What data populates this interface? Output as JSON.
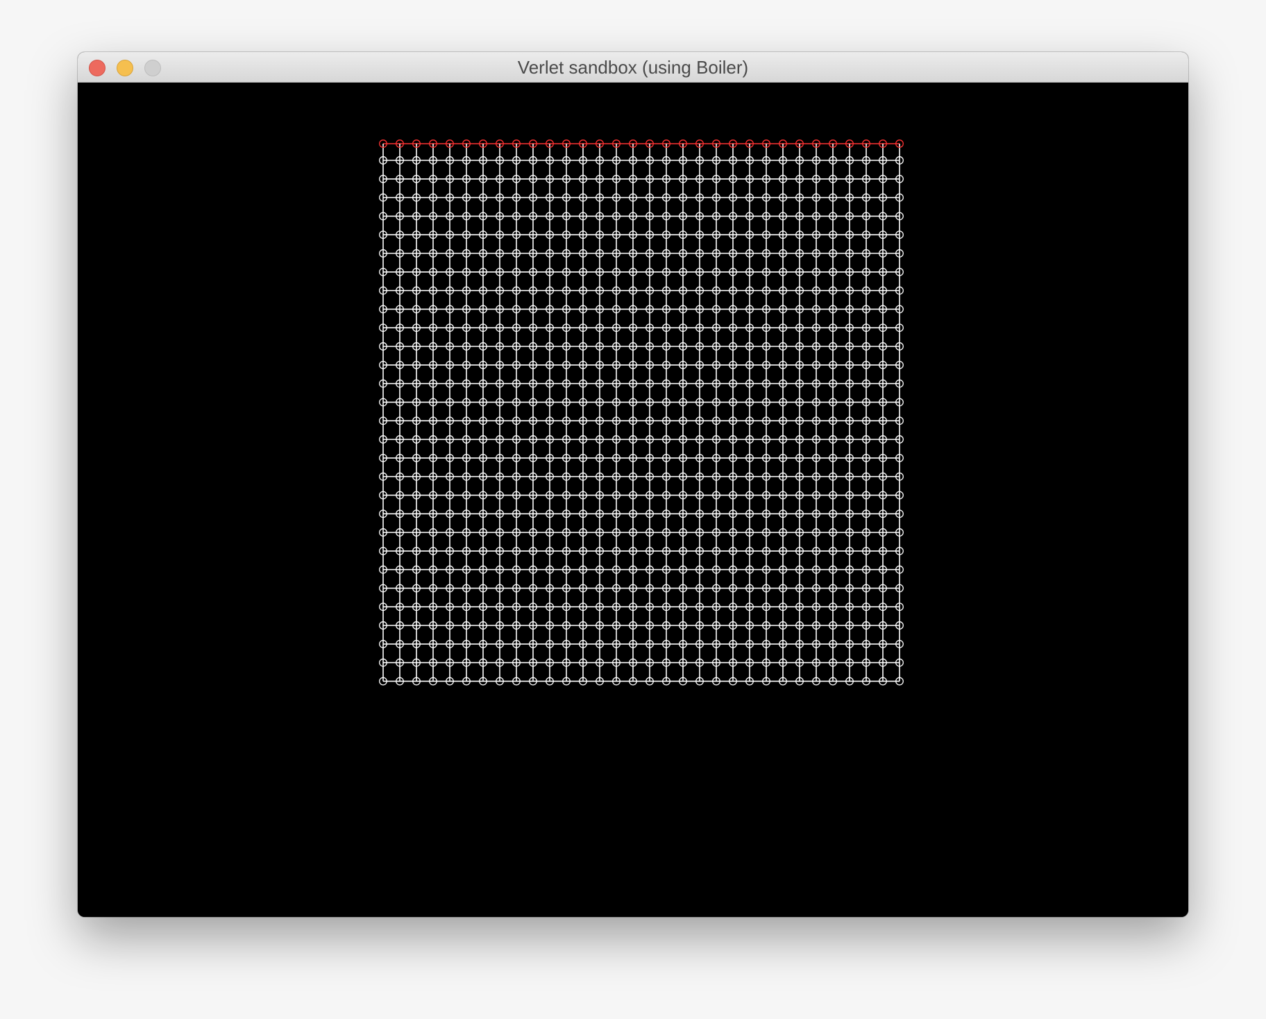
{
  "window": {
    "title": "Verlet sandbox (using Boiler)"
  },
  "traffic_lights": {
    "close_color": "#ed6a5e",
    "minimize_color": "#f5bf4f",
    "zoom_color": "#cfcfcf"
  },
  "scene": {
    "background_color": "#000000",
    "cloth": {
      "columns": 32,
      "rows": 30,
      "constraint_color": "#ffffff",
      "particle_color": "#ffffff",
      "pinned_particle_color": "#ff3333",
      "pinned_row": "top"
    }
  }
}
